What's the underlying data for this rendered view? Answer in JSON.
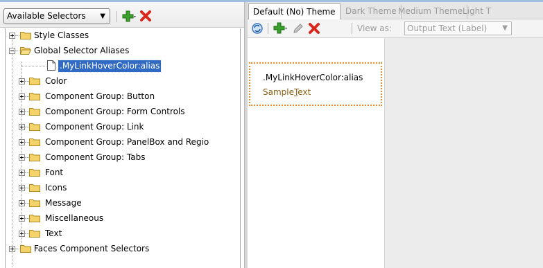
{
  "left_toolbar": {
    "selector_dropdown": "Available Selectors"
  },
  "tree": {
    "items": [
      {
        "label": "Style Classes"
      },
      {
        "label": "Global Selector Aliases"
      },
      {
        "label": ".MyLinkHoverColor:alias"
      },
      {
        "label": "Color"
      },
      {
        "label": "Component Group: Button"
      },
      {
        "label": "Component Group: Form Controls"
      },
      {
        "label": "Component Group: Link"
      },
      {
        "label": "Component Group: PanelBox and Regio"
      },
      {
        "label": "Component Group: Tabs"
      },
      {
        "label": "Font"
      },
      {
        "label": "Icons"
      },
      {
        "label": "Message"
      },
      {
        "label": "Miscellaneous"
      },
      {
        "label": "Text"
      },
      {
        "label": "Faces Component Selectors"
      }
    ]
  },
  "tabs": [
    {
      "label": "Default (No) Theme"
    },
    {
      "label": "Dark Theme"
    },
    {
      "label": "Medium Theme"
    },
    {
      "label": "Light T"
    }
  ],
  "right_toolbar": {
    "view_as_label": "View as:",
    "view_as_value": "Output Text (Label)"
  },
  "preview": {
    "selector_name": ".MyLinkHoverColor:alias",
    "sample_prefix": "Sample",
    "sample_underlined": "T",
    "sample_suffix": "ext"
  },
  "colors": {
    "selection": "#316ac5",
    "preview_border": "#f08a2a",
    "sample_text": "#8b5e14",
    "add_icon": "#3aa02c",
    "delete_icon": "#d8261a"
  }
}
